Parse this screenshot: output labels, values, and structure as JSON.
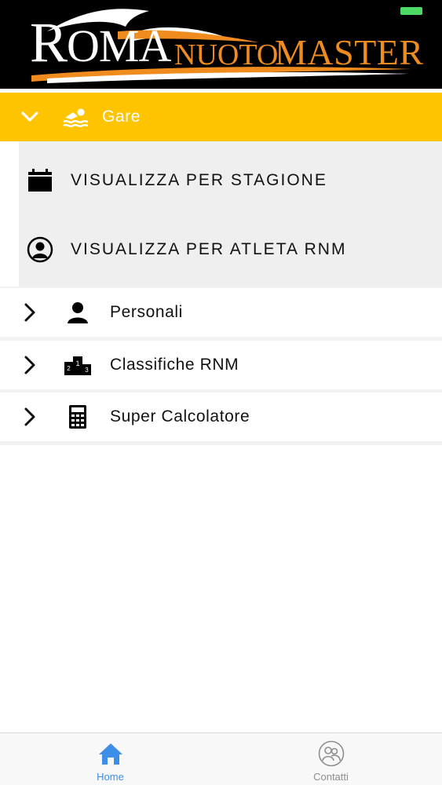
{
  "header": {
    "logo_text": "ROMA NUOTO MASTER"
  },
  "menu": {
    "gare": {
      "label": "Gare",
      "icon": "swimmer-icon",
      "expanded": true
    },
    "submenu": [
      {
        "label": "VISUALIZZA PER STAGIONE",
        "icon": "calendar-icon"
      },
      {
        "label": "VISUALIZZA PER ATLETA RNM",
        "icon": "user-circle-icon"
      }
    ],
    "items": [
      {
        "label": "Personali",
        "icon": "person-icon"
      },
      {
        "label": "Classifiche RNM",
        "icon": "podium-icon"
      },
      {
        "label": "Super Calcolatore",
        "icon": "calculator-icon"
      }
    ]
  },
  "tabbar": {
    "tabs": [
      {
        "label": "Home",
        "icon": "home-icon",
        "active": true
      },
      {
        "label": "Contatti",
        "icon": "contacts-icon",
        "active": false
      }
    ]
  },
  "colors": {
    "accent_yellow": "#ffc400",
    "logo_orange": "#f08c1e",
    "tab_active": "#3d8ee8",
    "tab_inactive": "#8e8e8e"
  }
}
